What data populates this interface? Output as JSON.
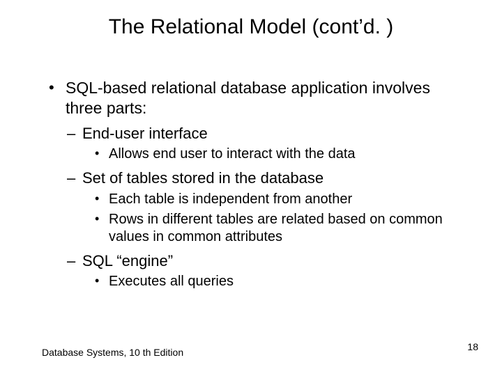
{
  "slide": {
    "title": "The Relational Model (cont’d. )",
    "bullets": {
      "l1_0": "SQL-based relational database application involves three parts:",
      "l2_0": "End-user interface",
      "l3_0": "Allows end user to interact with the data",
      "l2_1": "Set of tables stored in the database",
      "l3_1": "Each table is independent from another",
      "l3_2": "Rows in different tables are related based on common values in common attributes",
      "l2_2": "SQL “engine”",
      "l3_3": "Executes all queries"
    },
    "footer_left": "Database Systems, 10 th Edition",
    "page_number": "18"
  }
}
